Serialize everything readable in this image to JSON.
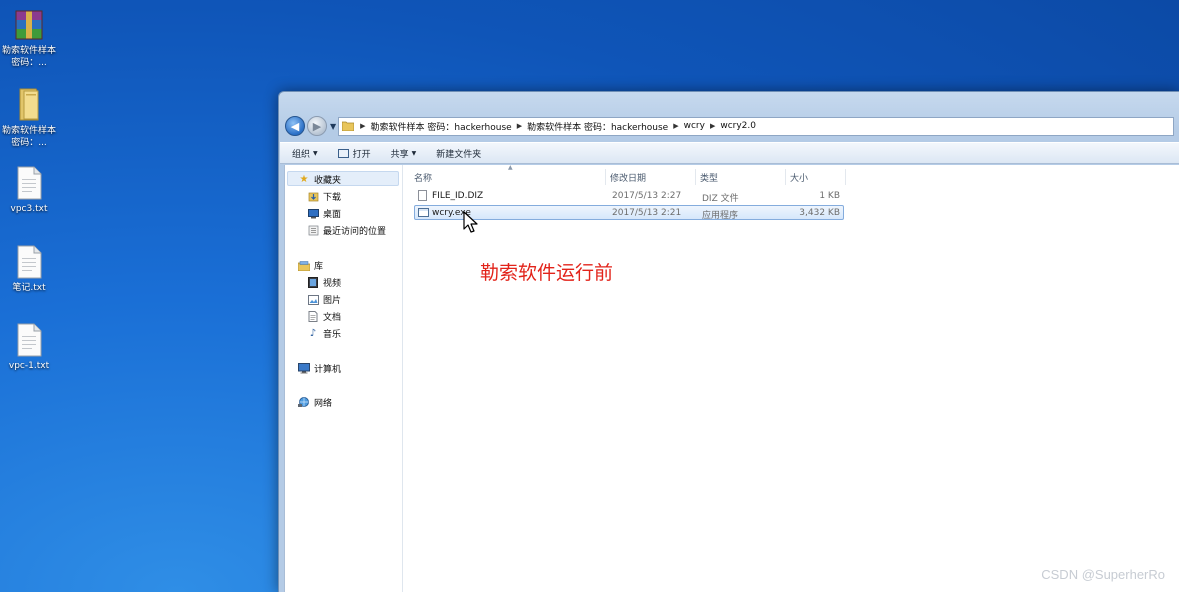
{
  "desktop": {
    "icons": [
      {
        "label": "勒索软件样本 密码：...",
        "icon": "winrar-archive-icon"
      },
      {
        "label": "勒索软件样本 密码：...",
        "icon": "folder-icon"
      },
      {
        "label": "vpc3.txt",
        "icon": "text-file-icon"
      },
      {
        "label": "笔记.txt",
        "icon": "text-file-icon"
      },
      {
        "label": "vpc-1.txt",
        "icon": "text-file-icon"
      }
    ]
  },
  "explorer": {
    "breadcrumb": [
      "勒索软件样本 密码：hackerhouse",
      "勒索软件样本 密码：hackerhouse",
      "wcry",
      "wcry2.0"
    ],
    "toolbar": {
      "organize": "组织",
      "open": "打开",
      "share": "共享",
      "new_folder": "新建文件夹"
    },
    "nav": {
      "favorites": "收藏夹",
      "downloads": "下载",
      "desktop": "桌面",
      "recent": "最近访问的位置",
      "libraries": "库",
      "videos": "视频",
      "pictures": "图片",
      "documents": "文档",
      "music": "音乐",
      "computer": "计算机",
      "network": "网络"
    },
    "columns": {
      "name": "名称",
      "modified": "修改日期",
      "type": "类型",
      "size": "大小"
    },
    "files": [
      {
        "name": "FILE_ID.DIZ",
        "modified": "2017/5/13 2:27",
        "type": "DIZ 文件",
        "size": "1 KB",
        "selected": false
      },
      {
        "name": "wcry.exe",
        "modified": "2017/5/13 2:21",
        "type": "应用程序",
        "size": "3,432 KB",
        "selected": true
      }
    ]
  },
  "annotation": "勒索软件运行前",
  "watermark": "CSDN @SuperherRo"
}
